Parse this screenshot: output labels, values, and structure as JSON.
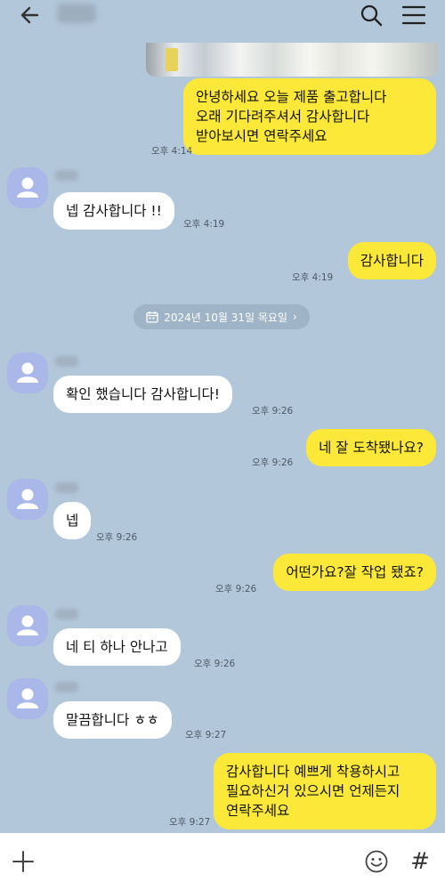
{
  "header": {
    "chat_name": "운영",
    "icons": {
      "back": "back-arrow-icon",
      "search": "search-icon",
      "menu": "hamburger-menu-icon"
    }
  },
  "colors": {
    "background": "#b2c7da",
    "my_bubble": "#fbe838",
    "their_bubble": "#ffffff",
    "avatar": "#a9b8e9"
  },
  "photo": {
    "icon": "product-photo-thumbnail"
  },
  "messages": [
    {
      "from": "me",
      "text": "안녕하세요 오늘 제품 출고합니다\n오래 기다려주셔서 감사합니다\n받아보시면 연락주세요",
      "time": "오후 4:14"
    },
    {
      "from": "them",
      "sender": "운영",
      "text": "넵 감사합니다 !!",
      "time": "오후 4:19"
    },
    {
      "from": "me",
      "text": "감사합니다",
      "time": "오후 4:19"
    },
    {
      "from": "them",
      "sender": "운영",
      "text": "확인 했습니다 감사합니다!",
      "time": "오후 9:26"
    },
    {
      "from": "me",
      "text": "네 잘 도착됐나요?",
      "time": "오후 9:26"
    },
    {
      "from": "them",
      "sender": "운영",
      "text": "넵",
      "time": "오후 9:26"
    },
    {
      "from": "me",
      "text": "어떤가요?잘 작업 됐죠?",
      "time": "오후 9:26"
    },
    {
      "from": "them",
      "sender": "운영",
      "text": "네 티 하나 안나고",
      "time": "오후 9:26"
    },
    {
      "from": "them",
      "sender": "운영",
      "text": "말끔합니다 ㅎㅎ",
      "time": "오후 9:27"
    },
    {
      "from": "me",
      "text": "감사합니다 예쁘게 착용하시고\n필요하신거 있으시면 언제든지\n연락주세요",
      "time": "오후 9:27"
    }
  ],
  "date_divider": {
    "label": "2024년 10월 31일 목요일"
  },
  "composer": {
    "placeholder": "",
    "icons": {
      "plus": "plus-icon",
      "emoji": "emoji-icon",
      "hash": "hash-icon"
    },
    "hash_label": "#"
  }
}
